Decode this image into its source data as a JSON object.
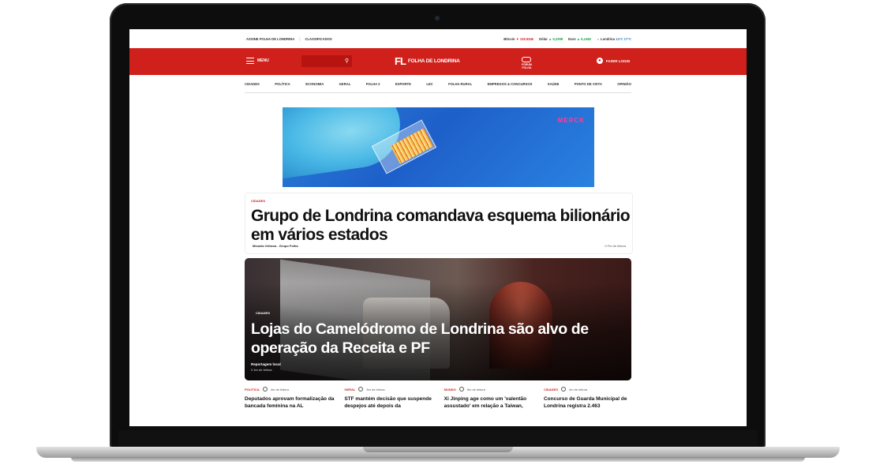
{
  "topbar": {
    "left": [
      "ASSINE FOLHA DE LONDRINA",
      "CLASSIFICADOS"
    ],
    "tickers": [
      {
        "label": "Bitcoin",
        "value": "▼ 119.034€",
        "dir": "down"
      },
      {
        "label": "Dólar",
        "value": "▲ 5,2398",
        "dir": "up"
      },
      {
        "label": "Euro",
        "value": "▲ 6,1482",
        "dir": "up"
      },
      {
        "label": "Londrina",
        "value": "14°C 17°C",
        "dir": "weather"
      }
    ]
  },
  "header": {
    "menu_label": "MENU",
    "logo_mark": "FL",
    "logo_name": "FOLHA DE LONDRINA",
    "forum_label": "FÓRUM\nFOLHA",
    "login_label": "FAZER LOGIN",
    "brand_color": "#d0201c"
  },
  "nav": [
    "CIDADES",
    "POLÍTICA",
    "ECONOMIA",
    "GERAL",
    "FOLHA 2",
    "ESPORTE",
    "LEC",
    "FOLHA RURAL",
    "EMPREGOS & CONCURSOS",
    "SAÚDE",
    "PONTO DE VISTA",
    "OPINIÃO"
  ],
  "ad": {
    "brand": "MERCK"
  },
  "lead": {
    "kicker": "CIDADES",
    "title": "Grupo de Londrina comandava esquema bilionário em vários estados",
    "byline": "Micaela Oribeza - Grupo Folha",
    "read_time": "0 Fm de leitura"
  },
  "hero": {
    "kicker": "CIDADES",
    "title": "Lojas do Camelódromo de Londrina são alvo de operação da Receita e PF",
    "author": "Reportagem local",
    "time": "0 4m de leitura"
  },
  "minis": [
    {
      "kicker": "POLÍTICA",
      "time": "4m de leitura",
      "title": "Deputados aprovam formalização da bancada feminina na AL"
    },
    {
      "kicker": "GERAL",
      "time": "5m de leitura",
      "title": "STF mantém decisão que suspende despejos até depois da"
    },
    {
      "kicker": "MUNDO",
      "time": "5m de leitura",
      "title": "Xi Jinping age como um 'valentão assustado' em relação a Taiwan,"
    },
    {
      "kicker": "CIDADES",
      "time": "4m de leitura",
      "title": "Concurso de Guarda Municipal de Londrina registra 2.463"
    }
  ]
}
